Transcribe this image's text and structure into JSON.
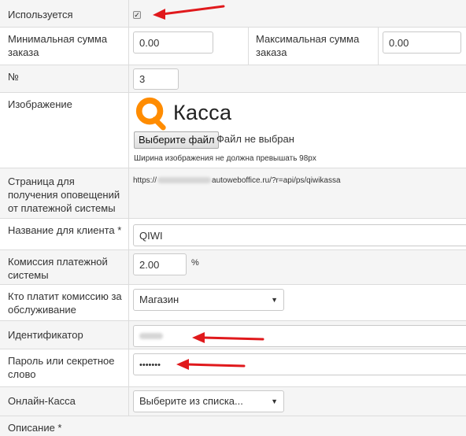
{
  "used": {
    "label": "Используется",
    "checked": true
  },
  "min_sum": {
    "label": "Минимальная сумма заказа",
    "value": "0.00"
  },
  "max_sum": {
    "label": "Максимальная сумма заказа",
    "value": "0.00"
  },
  "number": {
    "label": "№",
    "value": "3"
  },
  "image": {
    "label": "Изображение",
    "logo_text": "Касса",
    "file_button": "Выберите файл",
    "file_status": "Файл не выбран",
    "hint": "Ширина изображения не должна превышать 98px"
  },
  "notify": {
    "label": "Страница для получения оповещений от платежной системы",
    "url_prefix": "https://",
    "url_suffix": "autoweboffice.ru/?r=api/ps/qiwikassa"
  },
  "client_name": {
    "label": "Название для клиента *",
    "value": "QIWI"
  },
  "commission": {
    "label": "Комиссия платежной системы",
    "value": "2.00",
    "unit": "%"
  },
  "who_pays": {
    "label": "Кто платит комиссию за обслуживание",
    "value": "Магазин"
  },
  "identifier": {
    "label": "Идентификатор"
  },
  "password": {
    "label": "Пароль или секретное слово",
    "value": "•••••••"
  },
  "online_kassa": {
    "label": "Онлайн-Касса",
    "value": "Выберите из списка..."
  },
  "description": {
    "label": "Описание *"
  },
  "colors": {
    "arrow": "#e0191c",
    "logo_orange": "#ff8c00",
    "row_grey": "#f5f5f5"
  }
}
